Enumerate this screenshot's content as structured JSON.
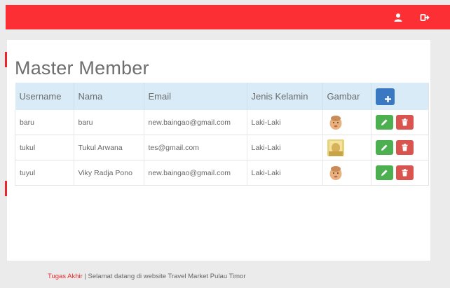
{
  "topbar": {
    "color": "#fb2f34",
    "icons": [
      "user-icon",
      "sign-out-icon"
    ]
  },
  "page": {
    "title": "Master Member"
  },
  "table": {
    "headers": [
      "Username",
      "Nama",
      "Email",
      "Jenis Kelamin",
      "Gambar"
    ],
    "add_button_icon": "plus-icon",
    "rows": [
      {
        "username": "baru",
        "nama": "baru",
        "email": "new.baingao@gmail.com",
        "jenis_kelamin": "Laki-Laki",
        "gambar": "avatar-baby"
      },
      {
        "username": "tukul",
        "nama": "Tukul Arwana",
        "email": "tes@gmail.com",
        "jenis_kelamin": "Laki-Laki",
        "gambar": "avatar-yellow"
      },
      {
        "username": "tuyul",
        "nama": "Viky Radja Pono",
        "email": "new.baingao@gmail.com",
        "jenis_kelamin": "Laki-Laki",
        "gambar": "avatar-baby"
      }
    ],
    "row_actions": [
      "pencil-icon",
      "trash-icon"
    ]
  },
  "footer": {
    "brand": "Tugas Akhir",
    "text": "| Selamat datang di website Travel Market Pulau Timor"
  },
  "colors": {
    "accent": "#fb2f34",
    "primary": "#3a78c2",
    "success": "#4cb050",
    "danger": "#d9534f",
    "header_row": "#d8ebf6"
  }
}
